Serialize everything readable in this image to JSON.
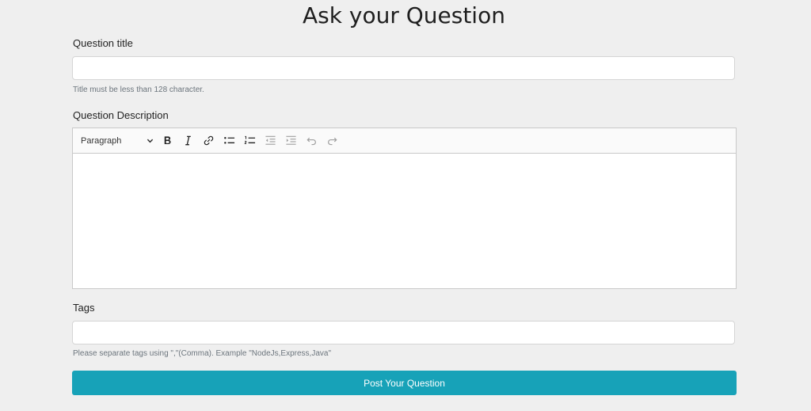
{
  "page": {
    "title": "Ask your Question"
  },
  "form": {
    "title_label": "Question title",
    "title_value": "",
    "title_help": "Title must be less than 128 character.",
    "description_label": "Question Description",
    "editor": {
      "heading_selected": "Paragraph",
      "content": "",
      "toolbar_icons": [
        "bold-icon",
        "italic-icon",
        "link-icon",
        "bulleted-list-icon",
        "numbered-list-icon",
        "outdent-icon",
        "indent-icon",
        "undo-icon",
        "redo-icon"
      ]
    },
    "tags_label": "Tags",
    "tags_value": "",
    "tags_help": "Please separate tags using \",\"(Comma). Example \"NodeJs,Express,Java\"",
    "submit_label": "Post Your Question"
  },
  "colors": {
    "background": "#efefef",
    "button": "#17a2b8",
    "button_text": "#ffffff"
  }
}
